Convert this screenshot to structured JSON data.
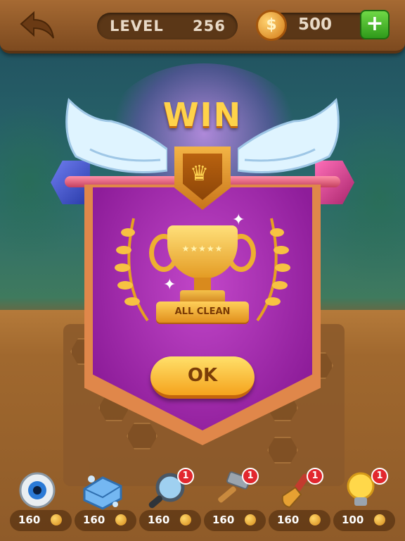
{
  "header": {
    "level_label": "LEVEL",
    "level_number": "256",
    "coin_symbol": "$",
    "coins": "500",
    "add_label": "+"
  },
  "win_popup": {
    "title": "WIN",
    "badge_text": "ALL CLEAN",
    "ok_label": "OK"
  },
  "tools": [
    {
      "icon": "eye-icon",
      "price": "160",
      "count": ""
    },
    {
      "icon": "soap-icon",
      "price": "160",
      "count": ""
    },
    {
      "icon": "magnifier-icon",
      "price": "160",
      "count": "1"
    },
    {
      "icon": "hammer-icon",
      "price": "160",
      "count": "1"
    },
    {
      "icon": "paintbrush-icon",
      "price": "160",
      "count": "1"
    },
    {
      "icon": "lightbulb-icon",
      "price": "100",
      "count": "1"
    }
  ],
  "colors": {
    "banner_purple": "#a02cab",
    "button_gold": "#f5a31d",
    "add_green": "#3aa822",
    "badge_red": "#e2272e"
  }
}
